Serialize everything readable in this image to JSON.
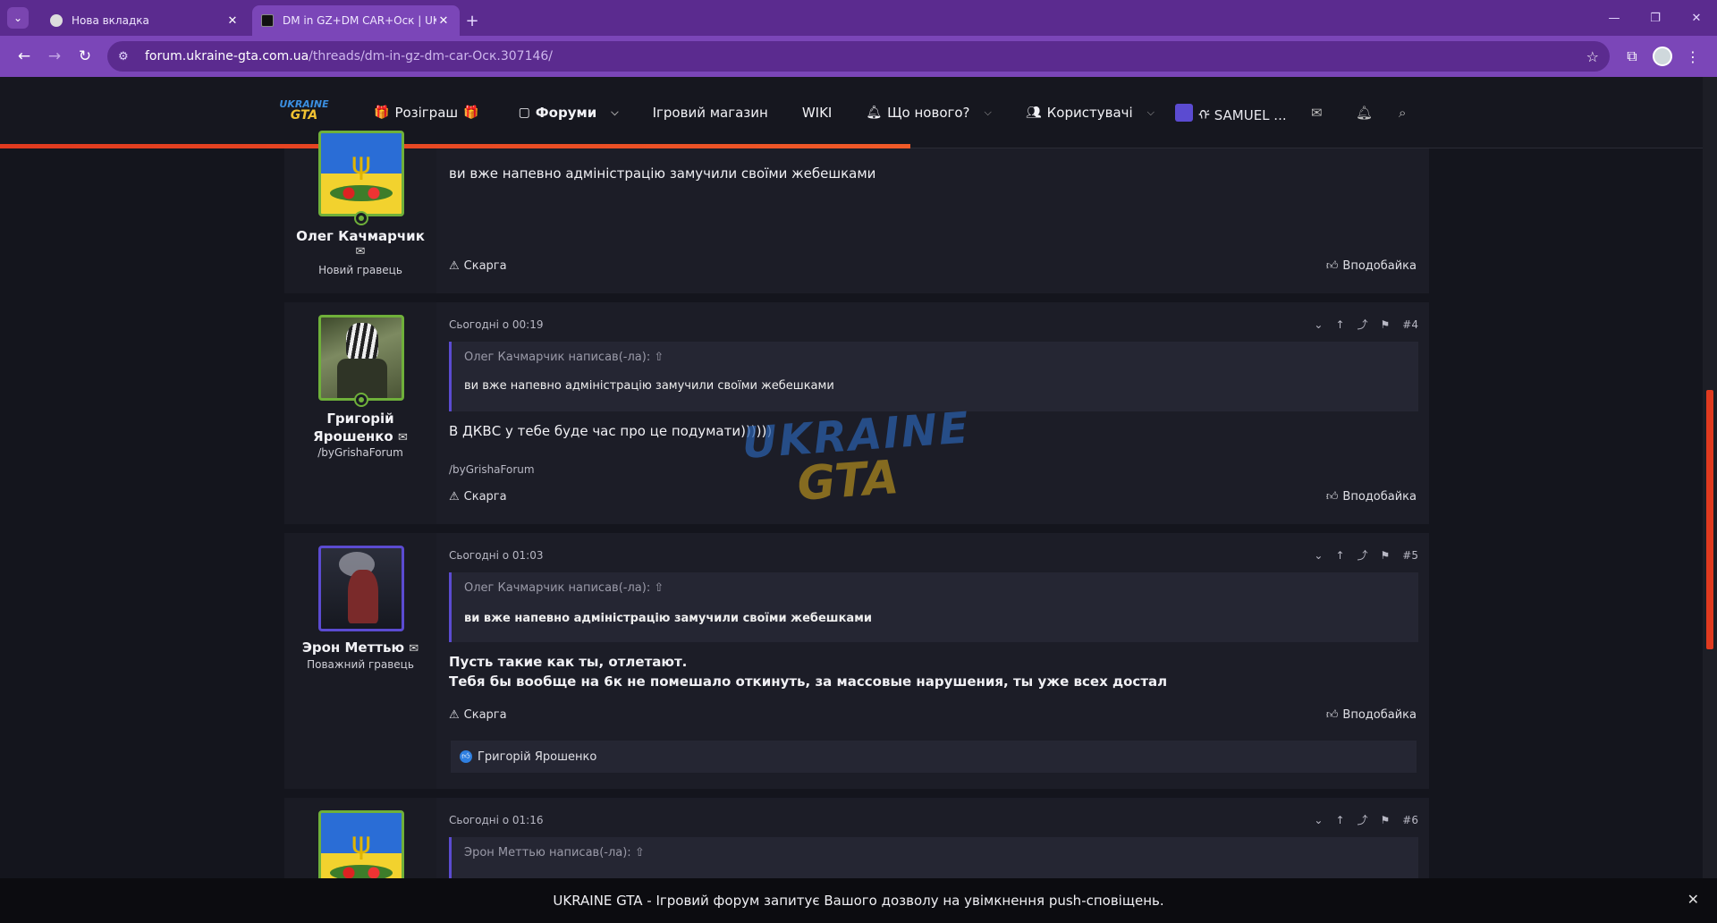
{
  "browser": {
    "tabs": [
      {
        "title": "Нова вкладка",
        "active": false
      },
      {
        "title": "DM in GZ+DM CAR+Оск | UKR",
        "active": true
      }
    ],
    "url_host": "forum.ukraine-gta.com.ua",
    "url_path": "/threads/dm-in-gz-dm-car-Оск.307146/"
  },
  "site": {
    "logo_line1": "UKRAINE",
    "logo_line2": "GTA",
    "nav": [
      {
        "label": "Розіграш",
        "icon": "gift-icon"
      },
      {
        "label": "Форуми",
        "icon": "chat-icon",
        "dropdown": true
      },
      {
        "label": "Ігровий магазин"
      },
      {
        "label": "WIKI"
      },
      {
        "label": "Що нового?",
        "icon": "bell-icon",
        "dropdown": true
      },
      {
        "label": "Користувачі",
        "icon": "users-icon",
        "dropdown": true
      }
    ],
    "username": "ᡤ SAMUEL ..."
  },
  "posts": [
    {
      "author": "Олег Качмарчик",
      "role": "Новий гравець",
      "text": "ви вже напевно адміністрацію замучили своїми жебешками",
      "report": "Скарга",
      "like": "Вподобайка"
    },
    {
      "author": "Григорій Ярошенко",
      "role": "/byGrishaForum",
      "time": "Сьогодні о 00:19",
      "num": "#4",
      "quote_head": "Олег Качмарчик написав(-ла):",
      "quote_text": "ви вже напевно адміністрацію замучили своїми жебешками",
      "text": "В ДКВС у тебе буде час про це подумати))))))",
      "signature": "/byGrishaForum",
      "report": "Скарга",
      "like": "Вподобайка"
    },
    {
      "author": "Эрон Меттью",
      "role": "Поважний гравець",
      "time": "Сьогодні о 01:03",
      "num": "#5",
      "quote_head": "Олег Качмарчик написав(-ла):",
      "quote_text": "ви вже напевно адміністрацію замучили своїми жебешками",
      "text_line1": "Пусть такие как ты, отлетают.",
      "text_line2": "Тебя бы вообще на 6к не помешало откинуть, за массовые нарушения, ты уже всех достал",
      "report": "Скарга",
      "like": "Вподобайка",
      "liked_by": "Григорій Ярошенко"
    },
    {
      "time": "Сьогодні о 01:16",
      "num": "#6",
      "quote_head": "Эрон Меттью написав(-ла):"
    }
  ],
  "watermark": {
    "line1": "UKRAINE",
    "line2": "GTA"
  },
  "push_notice": "UKRAINE GTA - Ігровий форум запитує Вашого дозволу на увімкнення push-сповіщень.",
  "colors": {
    "accent": "#5b4bd1",
    "progress": "#e03a1f",
    "browser": "#7b46b8"
  }
}
